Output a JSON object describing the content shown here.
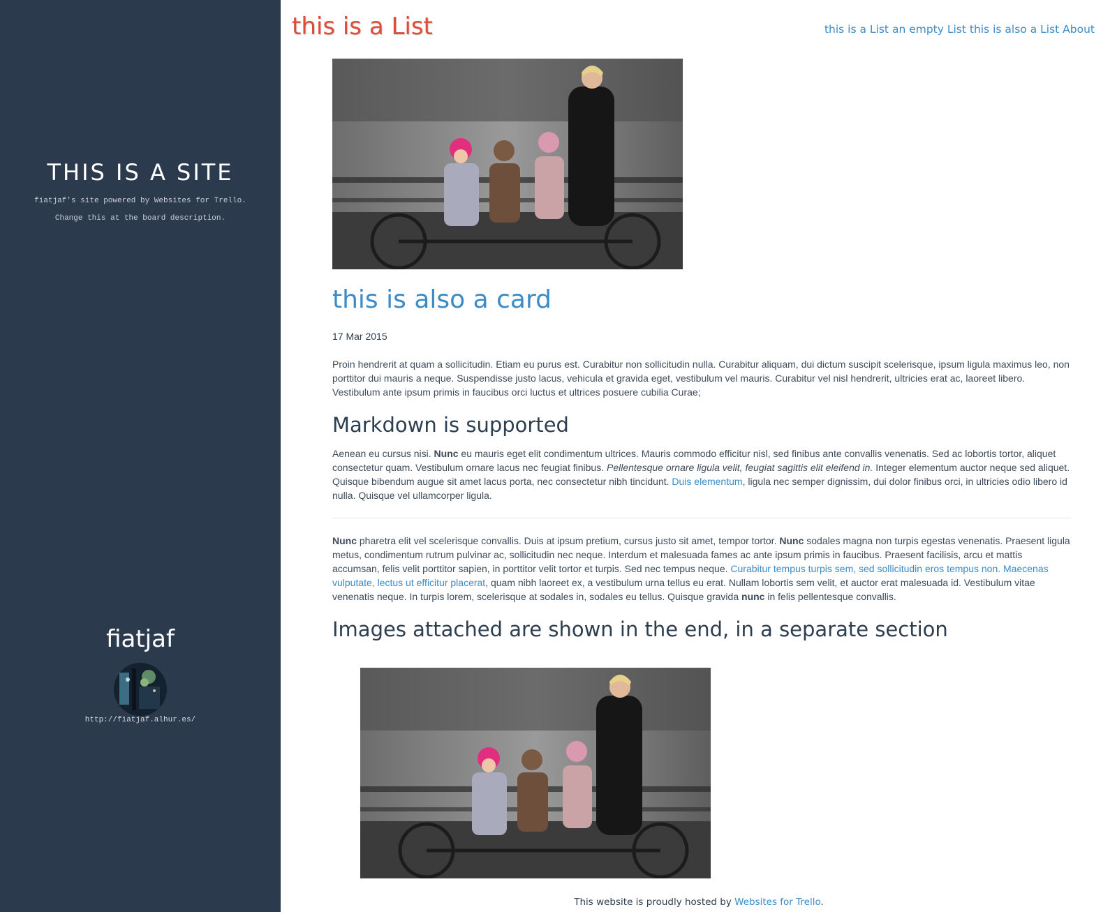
{
  "sidebar": {
    "site_title": "THIS IS A SITE",
    "site_desc_line1": "fiatjaf's site powered by Websites for Trello.",
    "site_desc_line2": "Change this at the board description.",
    "author_name": "fiatjaf",
    "author_url": "http://fiatjaf.alhur.es/"
  },
  "header": {
    "list_title": "this is a List",
    "nav": [
      {
        "label": "this is a List"
      },
      {
        "label": "an empty List"
      },
      {
        "label": "this is also a List"
      },
      {
        "label": "About"
      }
    ]
  },
  "card": {
    "title": "this is also a card",
    "date": "17 Mar 2015",
    "intro": "Proin hendrerit at quam a sollicitudin. Etiam eu purus est. Curabitur non sollicitudin nulla. Curabitur aliquam, dui dictum suscipit scelerisque, ipsum ligula maximus leo, non porttitor dui mauris a neque. Suspendisse justo lacus, vehicula et gravida eget, vestibulum vel mauris. Curabitur vel nisl hendrerit, ultricies erat ac, laoreet libero. Vestibulum ante ipsum primis in faucibus orci luctus et ultrices posuere cubilia Curae;",
    "h2_markdown": "Markdown is supported",
    "p2": {
      "a": "Aenean eu cursus nisi. ",
      "b_bold": "Nunc",
      "c": " eu mauris eget elit condimentum ultrices. Mauris commodo efficitur nisl, sed finibus ante convallis venenatis. Sed ac lobortis tortor, aliquet consectetur quam. Vestibulum ornare lacus nec feugiat finibus. ",
      "d_italic": "Pellentesque ornare ligula velit, feugiat sagittis elit eleifend in.",
      "e": " Integer elementum auctor neque sed aliquet. Quisque bibendum augue sit amet lacus porta, nec consectetur nibh tincidunt. ",
      "f_link": "Duis elementum",
      "g": ", ligula nec semper dignissim, dui dolor finibus orci, in ultricies odio libero id nulla. Quisque vel ullamcorper ligula."
    },
    "p3": {
      "a_bold": "Nunc",
      "b": " pharetra elit vel scelerisque convallis. Duis at ipsum pretium, cursus justo sit amet, tempor tortor. ",
      "c_bold": "Nunc",
      "d": " sodales magna non turpis egestas venenatis. Praesent ligula metus, condimentum rutrum pulvinar ac, sollicitudin nec neque. Interdum et malesuada fames ac ante ipsum primis in faucibus. Praesent facilisis, arcu et mattis accumsan, felis velit porttitor sapien, in porttitor velit tortor et turpis. Sed nec tempus neque. ",
      "e_link": "Curabitur tempus turpis sem, sed sollicitudin eros tempus non. Maecenas vulputate, lectus ut efficitur placerat",
      "f": ", quam nibh laoreet ex, a vestibulum urna tellus eu erat. Nullam lobortis sem velit, et auctor erat malesuada id. Vestibulum vitae venenatis neque. In turpis lorem, scelerisque at sodales in, sodales eu tellus. Quisque gravida ",
      "g_bold": "nunc",
      "h": " in felis pellentesque convallis."
    },
    "h2_images": "Images attached are shown in the end, in a separate section"
  },
  "footer": {
    "text": "This website is proudly hosted by ",
    "link": "Websites for Trello",
    "end": "."
  },
  "colors": {
    "sidebar_bg": "#2c3a4e",
    "accent_link": "#3a8bc7",
    "list_title": "#e04b3a",
    "heading": "#2c3e50"
  }
}
